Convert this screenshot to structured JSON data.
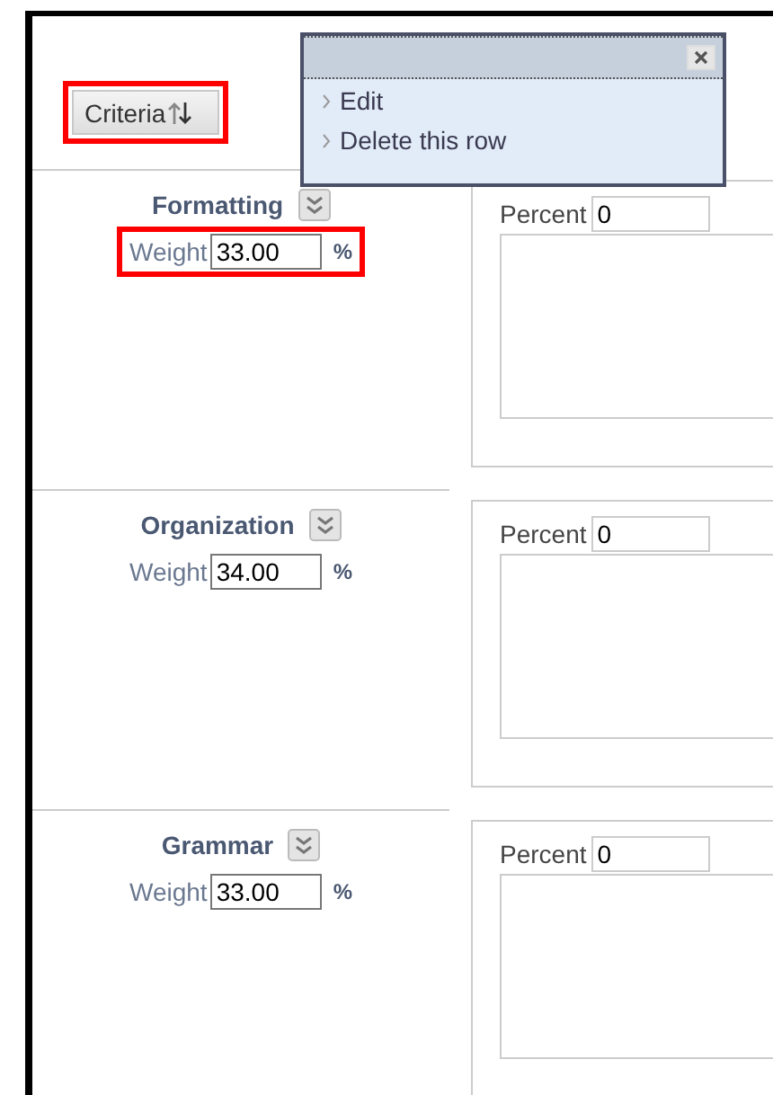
{
  "header": {
    "sort_button": {
      "label": "Criteria",
      "highlighted": true
    }
  },
  "popup_menu": {
    "items": [
      {
        "label": "Edit"
      },
      {
        "label": "Delete this row"
      }
    ]
  },
  "criteria": [
    {
      "name": "Formatting",
      "weight_label": "Weight",
      "weight": "33.00",
      "unit": "%",
      "weight_highlighted": true,
      "percent_label": "Percent",
      "percent": "0"
    },
    {
      "name": "Organization",
      "weight_label": "Weight",
      "weight": "34.00",
      "unit": "%",
      "weight_highlighted": false,
      "percent_label": "Percent",
      "percent": "0"
    },
    {
      "name": "Grammar",
      "weight_label": "Weight",
      "weight": "33.00",
      "unit": "%",
      "weight_highlighted": false,
      "percent_label": "Percent",
      "percent": "0"
    }
  ]
}
